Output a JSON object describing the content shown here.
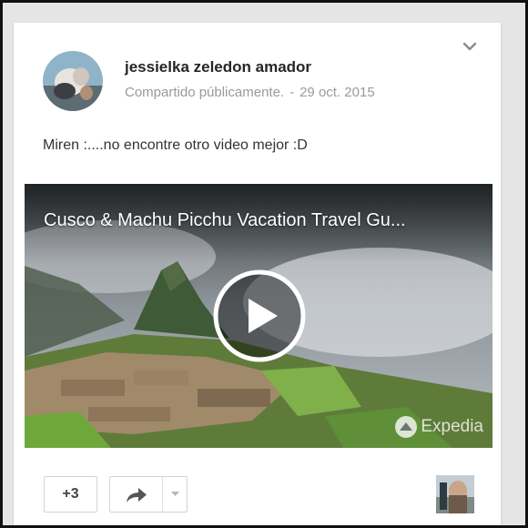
{
  "post": {
    "author": "jessielka zeledon amador",
    "visibility": "Compartido públicamente.",
    "separator": "-",
    "date": "29 oct. 2015",
    "text": "Miren :....no encontre otro video mejor :D"
  },
  "video": {
    "title": "Cusco & Machu Picchu Vacation Travel Gu...",
    "brand": "Expedia"
  },
  "actions": {
    "plus_count": "+3"
  },
  "icons": {
    "menu": "chevron-down-icon",
    "play": "play-icon",
    "share": "share-icon",
    "dropdown": "caret-down-icon",
    "brand": "expedia-logo-icon"
  },
  "colors": {
    "author_text": "#262626",
    "meta_text": "#9a9a9a",
    "card_background": "#ffffff",
    "page_background": "#e5e5e5"
  }
}
